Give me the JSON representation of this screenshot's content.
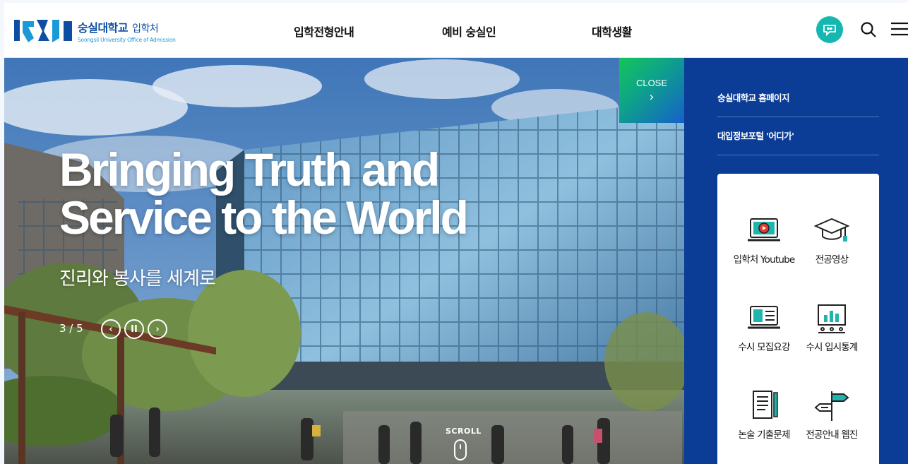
{
  "header": {
    "logo_ko": "숭실대학교",
    "logo_sub": "입학처",
    "logo_en": "Soongsil University Office of Admission",
    "nav": [
      "입학전형안내",
      "예비 숭실인",
      "대학생활"
    ]
  },
  "hero": {
    "title_line1": "Bringing Truth and",
    "title_line2": "Service to the World",
    "subtitle": "진리와 봉사를 세계로",
    "counter": "3 / 5",
    "prev": "‹",
    "pause": "II",
    "next": "›",
    "scroll": "SCROLL"
  },
  "panel": {
    "close_label": "CLOSE",
    "close_chevron": "›",
    "links": [
      "숭실대학교 홈페이지",
      "대입정보포털 '어디가'"
    ],
    "quick": [
      {
        "label": "입학처 Youtube",
        "icon": "youtube-laptop-icon"
      },
      {
        "label": "전공영상",
        "icon": "graduation-cap-icon"
      },
      {
        "label": "수시 모집요강",
        "icon": "guidebook-icon"
      },
      {
        "label": "수시 입시통계",
        "icon": "statistics-board-icon"
      },
      {
        "label": "논술 기출문제",
        "icon": "exam-paper-icon"
      },
      {
        "label": "전공안내 웹진",
        "icon": "signpost-icon"
      }
    ]
  },
  "colors": {
    "brand_blue": "#0d4ea3",
    "panel_blue": "#0c3d96",
    "teal": "#15b7b0"
  }
}
